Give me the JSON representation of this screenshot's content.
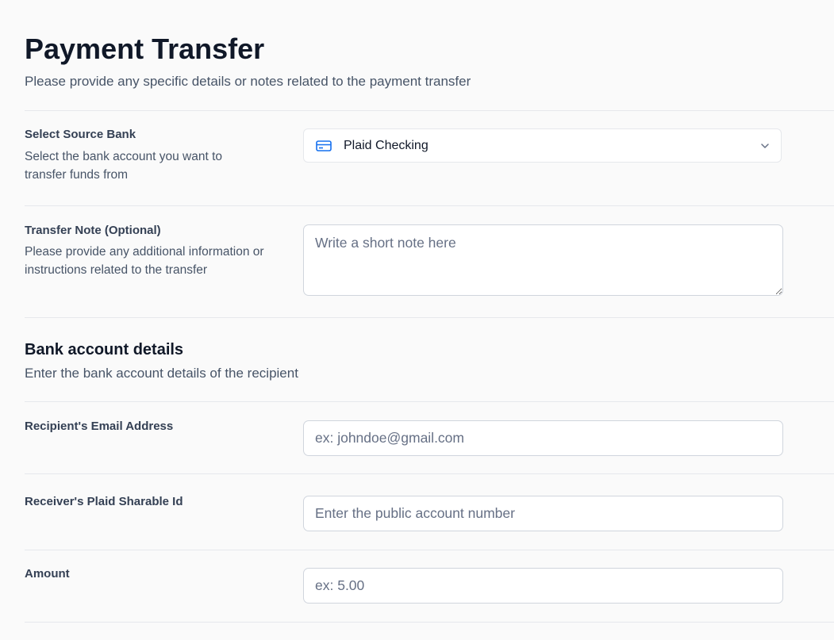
{
  "header": {
    "title": "Payment Transfer",
    "subtitle": "Please provide any specific details or notes related to the payment transfer"
  },
  "source_bank": {
    "label": "Select Source Bank",
    "help": "Select the bank account you want to transfer funds from",
    "selected": "Plaid Checking",
    "icon": "credit-card-icon",
    "chevron_icon": "chevron-down-icon"
  },
  "transfer_note": {
    "label": "Transfer Note (Optional)",
    "help": "Please provide any additional information or instructions related to the transfer",
    "value": "",
    "placeholder": "Write a short note here"
  },
  "bank_details": {
    "title": "Bank account details",
    "subtitle": "Enter the bank account details of the recipient"
  },
  "recipient_email": {
    "label": "Recipient's Email Address",
    "value": "",
    "placeholder": "ex: johndoe@gmail.com"
  },
  "sharable_id": {
    "label": "Receiver's Plaid Sharable Id",
    "value": "",
    "placeholder": "Enter the public account number"
  },
  "amount": {
    "label": "Amount",
    "value": "",
    "placeholder": "ex: 5.00"
  },
  "colors": {
    "accent": "#1570ef",
    "border": "#d0d5dd",
    "divider": "#e6e8ec",
    "heading": "#101828"
  }
}
